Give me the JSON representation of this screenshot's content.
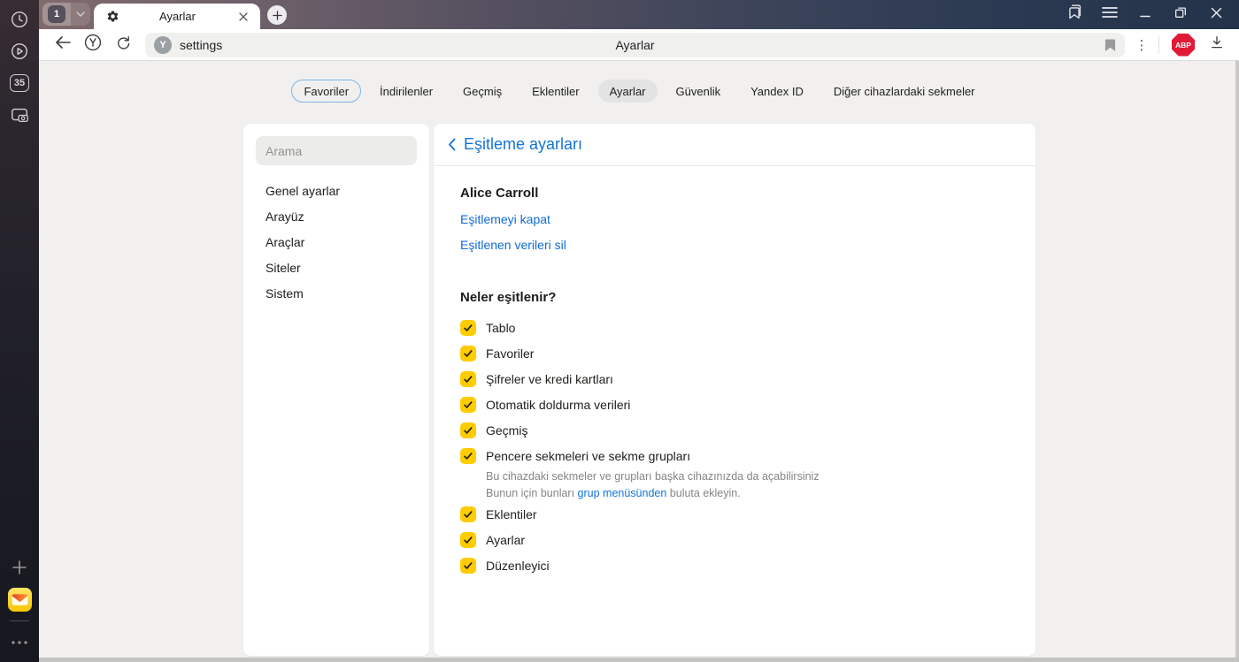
{
  "browser": {
    "rail": {
      "tab_count": "35"
    },
    "tab_bar": {
      "group_count": "1",
      "active_tab_title": "Ayarlar"
    },
    "toolbar": {
      "url_text": "settings",
      "center_title": "Ayarlar",
      "abp_label": "ABP"
    }
  },
  "nav": {
    "tabs": [
      {
        "label": "Favoriler",
        "state": "outlined"
      },
      {
        "label": "İndirilenler",
        "state": "normal"
      },
      {
        "label": "Geçmiş",
        "state": "normal"
      },
      {
        "label": "Eklentiler",
        "state": "normal"
      },
      {
        "label": "Ayarlar",
        "state": "active"
      },
      {
        "label": "Güvenlik",
        "state": "normal"
      },
      {
        "label": "Yandex ID",
        "state": "normal"
      },
      {
        "label": "Diğer cihazlardaki sekmeler",
        "state": "normal"
      }
    ]
  },
  "settings_sidebar": {
    "search_placeholder": "Arama",
    "items": [
      {
        "label": "Genel ayarlar"
      },
      {
        "label": "Arayüz"
      },
      {
        "label": "Araçlar"
      },
      {
        "label": "Siteler"
      },
      {
        "label": "Sistem"
      }
    ]
  },
  "sync_page": {
    "title": "Eşitleme ayarları",
    "account_name": "Alice Carroll",
    "link_disable": "Eşitlemeyi kapat",
    "link_delete": "Eşitlenen verileri sil",
    "section_title": "Neler eşitlenir?",
    "items": [
      {
        "label": "Tablo",
        "checked": true
      },
      {
        "label": "Favoriler",
        "checked": true
      },
      {
        "label": "Şifreler ve kredi kartları",
        "checked": true
      },
      {
        "label": "Otomatik doldurma verileri",
        "checked": true
      },
      {
        "label": "Geçmiş",
        "checked": true
      },
      {
        "label": "Pencere sekmeleri ve sekme grupları",
        "checked": true,
        "note_line1": "Bu cihazdaki sekmeler ve grupları başka cihazınızda da açabilirsiniz",
        "note_line2_before": "Bunun için bunları ",
        "note_line2_link": "grup menüsünden",
        "note_line2_after": " buluta ekleyin."
      },
      {
        "label": "Eklentiler",
        "checked": true
      },
      {
        "label": "Ayarlar",
        "checked": true
      },
      {
        "label": "Düzenleyici",
        "checked": true
      }
    ]
  },
  "colors": {
    "accent_blue": "#1374d4",
    "link_blue": "#0f6cd4",
    "checkbox_yellow": "#ffcc00",
    "abp_red": "#e01936",
    "favoriler_outline_blue": "#7eb5e8",
    "active_pill_gray": "#e3e3e3"
  }
}
